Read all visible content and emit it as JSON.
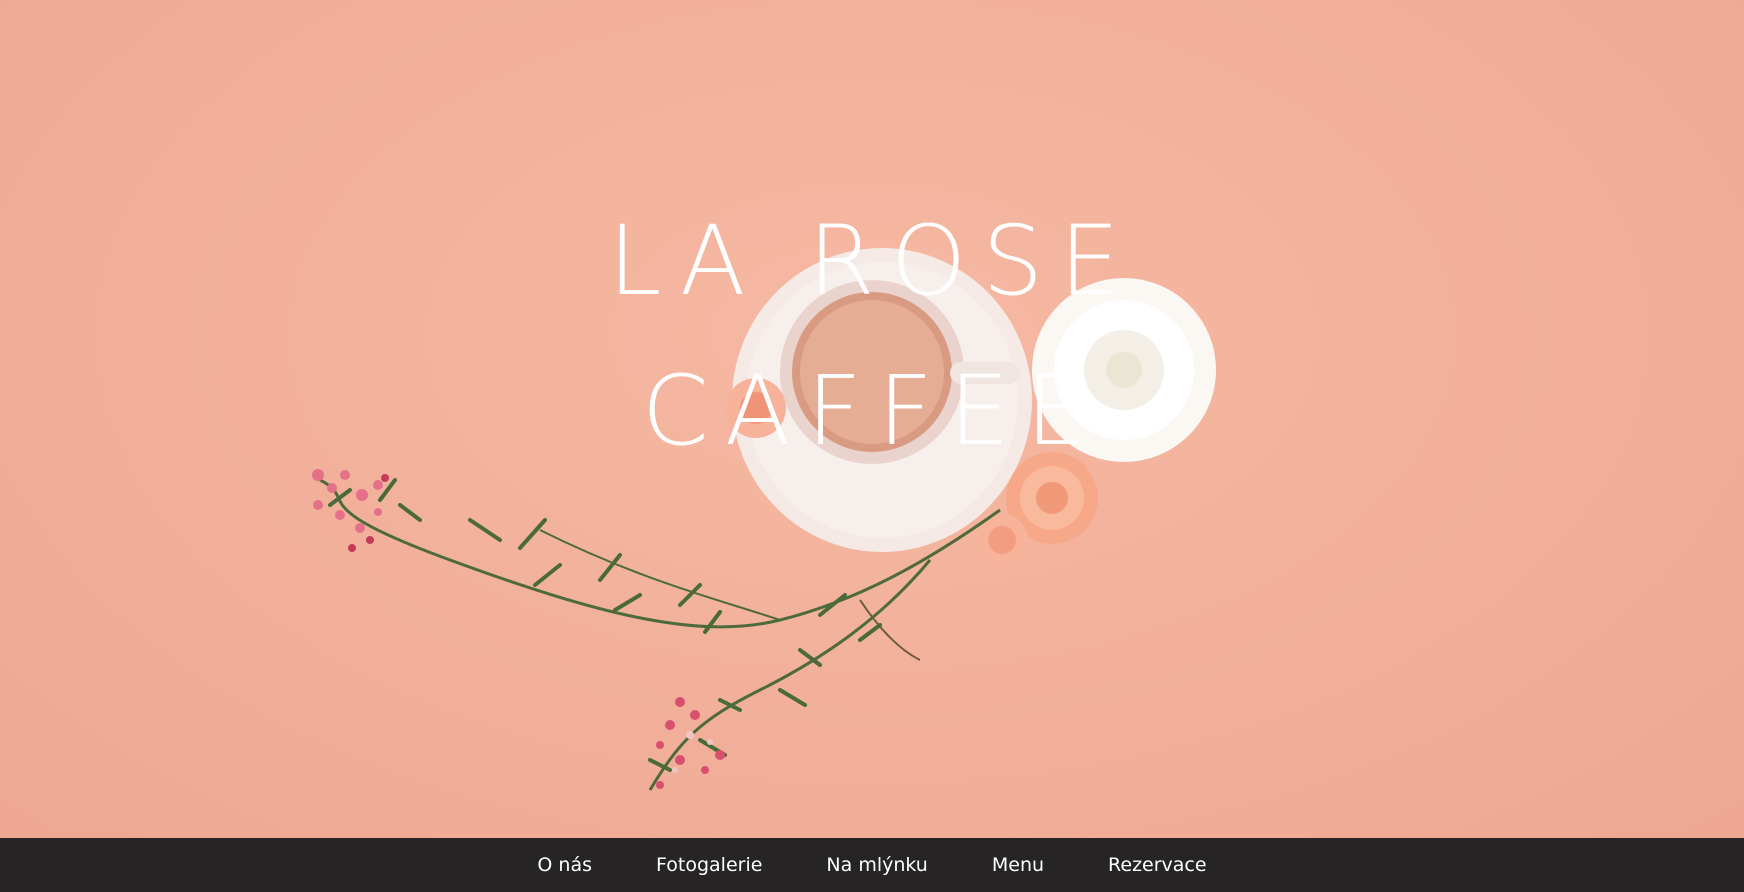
{
  "hero": {
    "title_line1": "LA ROSE",
    "title_line2": "CAFFEE",
    "image_icon": "coffee-cup-with-flowers-illustration"
  },
  "nav": {
    "items": [
      {
        "label": "O nás"
      },
      {
        "label": "Fotogalerie"
      },
      {
        "label": "Na mlýnku"
      },
      {
        "label": "Menu"
      },
      {
        "label": "Rezervace"
      }
    ]
  },
  "colors": {
    "background": "#f2b19b",
    "nav_background": "#262425",
    "title_text": "#ffffff",
    "nav_text": "#ffffff"
  }
}
